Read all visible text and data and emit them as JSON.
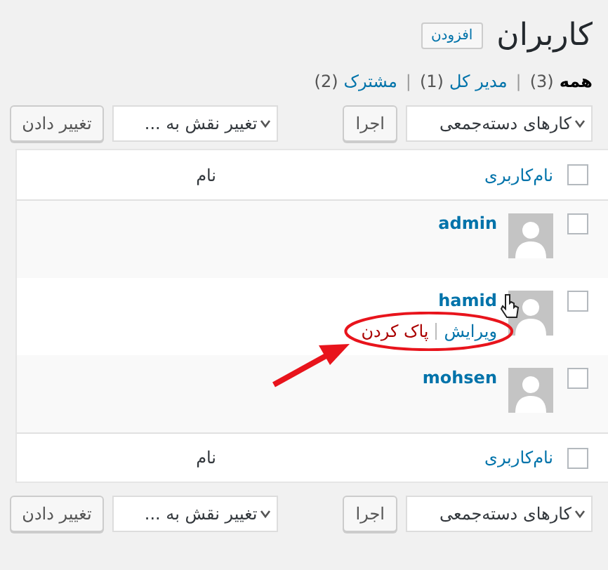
{
  "page_title": "کاربران",
  "add_button": "افزودن",
  "filters": [
    {
      "label": "همه",
      "count": "(3)",
      "selected": true
    },
    {
      "separator": "|",
      "label": "مدیر کل",
      "count": "(1)",
      "selected": false
    },
    {
      "separator": "|",
      "label": "مشترک",
      "count": "(2)",
      "selected": false
    }
  ],
  "top_toolbar": {
    "bulk_actions": "کارهای دسته‌جمعی",
    "apply": "اجرا",
    "change_role": "تغییر نقش به ...",
    "change": "تغییر دادن"
  },
  "table": {
    "columns": [
      "نام‌کاربری",
      "نام"
    ],
    "header_checked": false,
    "footer_checked": false,
    "rows": [
      {
        "username": "admin",
        "checked": false,
        "actions": []
      },
      {
        "username": "hamid",
        "checked": false,
        "actions": [
          {
            "label": "ویرایش",
            "kind": "edit"
          },
          {
            "label": "پاک کردن",
            "kind": "delete"
          }
        ]
      },
      {
        "username": "mohsen",
        "checked": false,
        "actions": []
      }
    ],
    "footer_columns": [
      "نام‌کاربری",
      "نام"
    ]
  },
  "bottom_toolbar": {
    "bulk_actions": "کارهای دسته‌جمعی",
    "apply": "اجرا",
    "change_role": "تغییر نقش به ...",
    "change": "تغییر دادن"
  }
}
